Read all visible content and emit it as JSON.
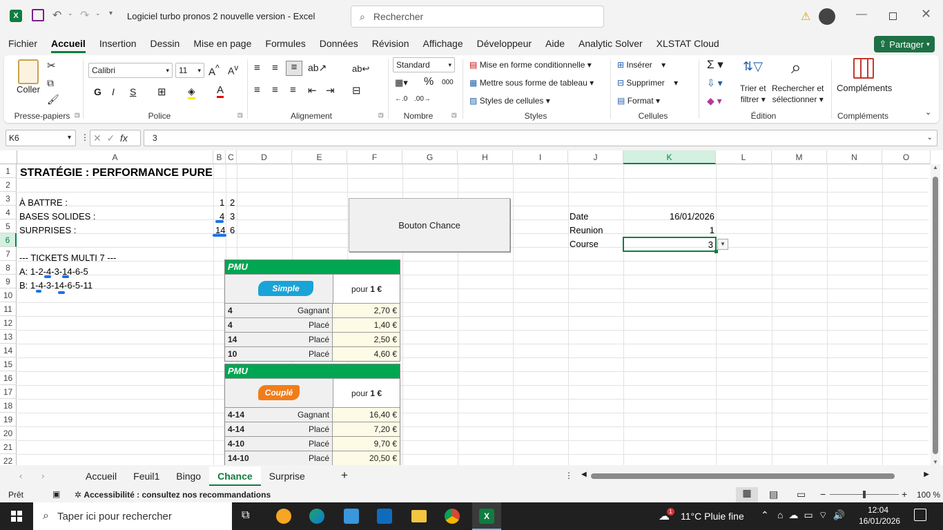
{
  "window": {
    "title": "Logiciel turbo pronos 2 nouvelle version  -  Excel",
    "search_placeholder": "Rechercher"
  },
  "menu": [
    "Fichier",
    "Accueil",
    "Insertion",
    "Dessin",
    "Mise en page",
    "Formules",
    "Données",
    "Révision",
    "Affichage",
    "Développeur",
    "Aide",
    "Analytic Solver",
    "XLSTAT Cloud"
  ],
  "share_label": "Partager",
  "ribbon": {
    "clipboard": {
      "label": "Presse-papiers",
      "paste": "Coller"
    },
    "font": {
      "label": "Police",
      "name": "Calibri",
      "size": "11",
      "bold": "G",
      "italic": "I",
      "underline": "S"
    },
    "alignment": {
      "label": "Alignement"
    },
    "number": {
      "label": "Nombre",
      "format": "Standard"
    },
    "styles": {
      "label": "Styles",
      "cond": "Mise en forme conditionnelle",
      "table": "Mettre sous forme de tableau",
      "cell": "Styles de cellules"
    },
    "cells": {
      "label": "Cellules",
      "insert": "Insérer",
      "delete": "Supprimer",
      "format": "Format"
    },
    "editing": {
      "label": "Édition",
      "sort1": "Trier et",
      "sort2": "filtrer",
      "find1": "Rechercher et",
      "find2": "sélectionner"
    },
    "addins": {
      "label": "Compléments",
      "btn": "Compléments"
    }
  },
  "formula": {
    "namebox": "K6",
    "value": "3"
  },
  "columns": [
    "A",
    "B",
    "C",
    "D",
    "E",
    "F",
    "G",
    "H",
    "I",
    "J",
    "K",
    "L",
    "M",
    "N",
    "O"
  ],
  "rows": [
    "1",
    "2",
    "3",
    "4",
    "5",
    "6",
    "7",
    "8",
    "9",
    "10",
    "11",
    "12",
    "13",
    "14",
    "15",
    "16",
    "17",
    "18",
    "19",
    "20",
    "21",
    "22"
  ],
  "cells": {
    "a1": "STRATÉGIE : PERFORMANCE PURE",
    "a3": "À BATTRE :",
    "b3": "1",
    "c3": "2",
    "a4": "BASES SOLIDES :",
    "b4": "4",
    "c4": "3",
    "a5": "SURPRISES :",
    "b5": "14",
    "c5": "6",
    "a7": "--- TICKETS MULTI 7 ---",
    "a8": "A: 1-2-4-3-14-6-5",
    "a9": "B: 1-4-3-14-6-5-11",
    "j4": "Date",
    "k4": "16/01/2026",
    "j5": "Reunion",
    "k5": "1",
    "j6": "Course",
    "k6": "3"
  },
  "button_chance": "Bouton Chance",
  "pmu1": {
    "brand": "PMU",
    "badge": "Simple",
    "pour": "pour",
    "mise": "1 €",
    "rows": [
      [
        "4",
        "Gagnant",
        "2,70 €"
      ],
      [
        "4",
        "Placé",
        "1,40 €"
      ],
      [
        "14",
        "Placé",
        "2,50 €"
      ],
      [
        "10",
        "Placé",
        "4,60 €"
      ]
    ]
  },
  "pmu2": {
    "brand": "PMU",
    "badge": "Couplé",
    "pour": "pour",
    "mise": "1 €",
    "rows": [
      [
        "4-14",
        "Gagnant",
        "16,40 €"
      ],
      [
        "4-14",
        "Placé",
        "7,20 €"
      ],
      [
        "4-10",
        "Placé",
        "9,70 €"
      ],
      [
        "14-10",
        "Placé",
        "20,50 €"
      ]
    ]
  },
  "sheets": [
    "Accueil",
    "Feuil1",
    "Bingo",
    "Chance",
    "Surprise"
  ],
  "active_sheet": "Chance",
  "status": {
    "ready": "Prêt",
    "access": "Accessibilité : consultez nos recommandations",
    "zoom": "100 %"
  },
  "taskbar": {
    "search": "Taper ici pour rechercher",
    "weather": "11°C  Pluie fine",
    "time": "12:04",
    "date": "16/01/2026",
    "notif": "1"
  }
}
